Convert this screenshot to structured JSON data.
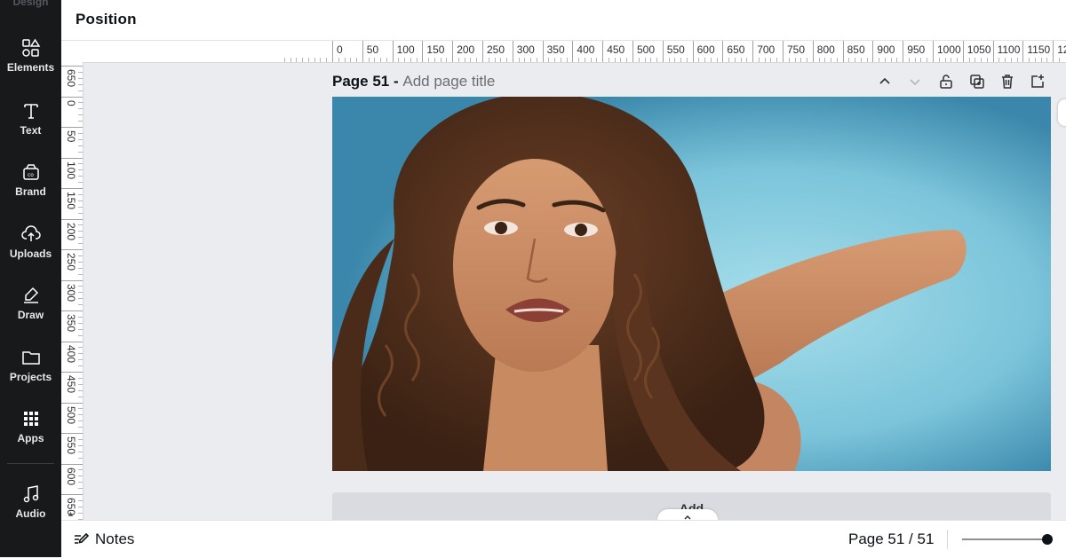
{
  "rail": {
    "cut_label": "Design",
    "items": [
      {
        "label": "Elements",
        "icon": "elements-icon"
      },
      {
        "label": "Text",
        "icon": "text-icon"
      },
      {
        "label": "Brand",
        "icon": "brand-icon"
      },
      {
        "label": "Uploads",
        "icon": "uploads-icon"
      },
      {
        "label": "Draw",
        "icon": "draw-icon"
      },
      {
        "label": "Projects",
        "icon": "projects-icon"
      },
      {
        "label": "Apps",
        "icon": "apps-icon"
      },
      {
        "label": "Audio",
        "icon": "audio-icon"
      }
    ]
  },
  "header": {
    "title": "Position"
  },
  "ruler": {
    "horizontal": [
      "0",
      "50",
      "100",
      "150",
      "200",
      "250",
      "300",
      "350",
      "400",
      "450",
      "500",
      "550",
      "600",
      "650",
      "700",
      "750",
      "800",
      "850",
      "900",
      "950",
      "1000",
      "1050",
      "1100",
      "1150",
      "12"
    ],
    "vertical": [
      "650",
      "0",
      "50",
      "100",
      "150",
      "200",
      "250",
      "300",
      "350",
      "400",
      "450",
      "500",
      "550",
      "600",
      "650"
    ]
  },
  "page": {
    "title_prefix": "Page 51 - ",
    "title_placeholder": "Add page title",
    "image_description": "portrait photo on blue background"
  },
  "add_page": {
    "label": "Add"
  },
  "bottom": {
    "notes_label": "Notes",
    "page_indicator": "Page 51 / 51",
    "zoom_fraction": 0.96
  },
  "colors": {
    "rail_bg": "#18191b",
    "canvas_bg": "#7cc6dc",
    "workspace_bg": "#ebecf0"
  }
}
